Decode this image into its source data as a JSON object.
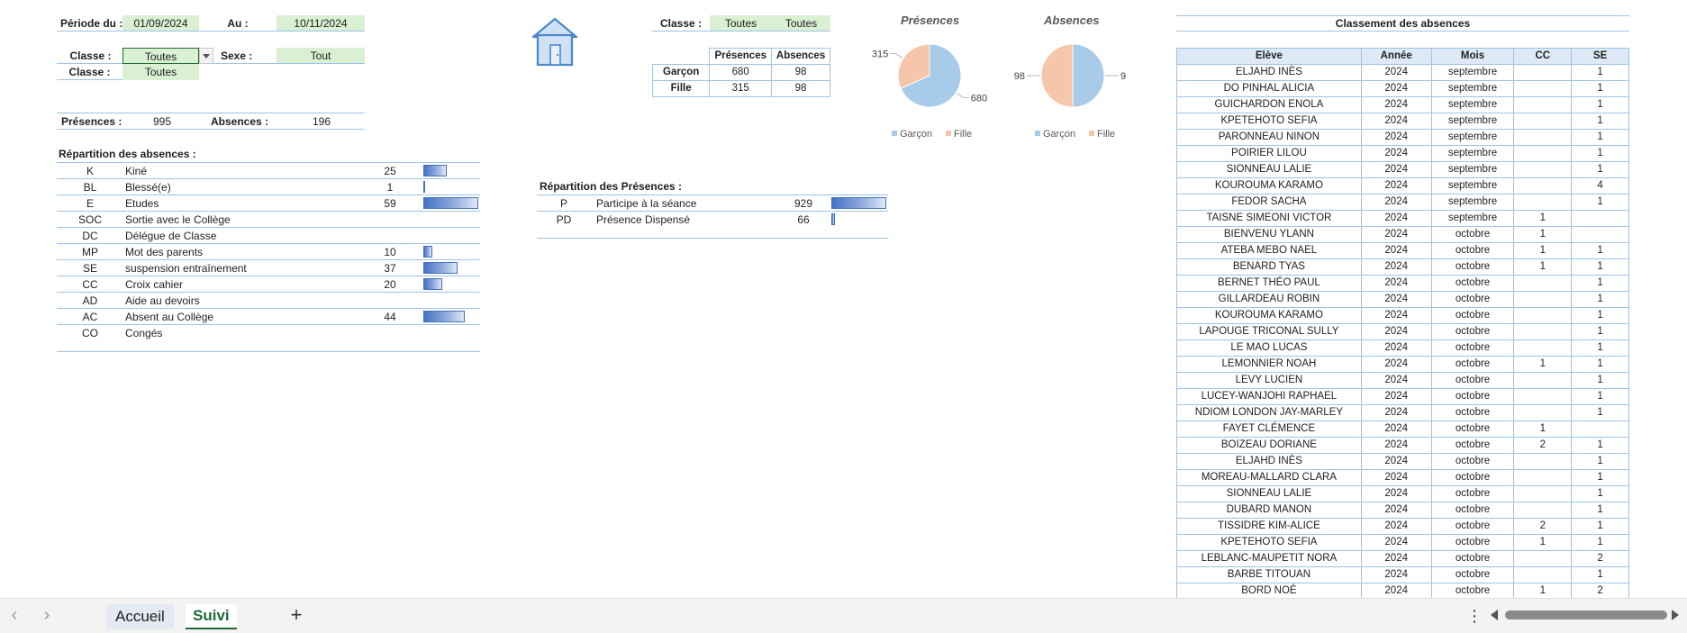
{
  "filters": {
    "periode_label": "Période du :",
    "periode_from": "01/09/2024",
    "au_label": "Au :",
    "periode_to": "10/11/2024",
    "classe_label": "Classe :",
    "classe_value": "Toutes",
    "sexe_label": "Sexe :",
    "sexe_value": "Tout",
    "classe2_label": "Classe :",
    "classe2_value": "Toutes"
  },
  "totals": {
    "presences_label": "Présences :",
    "presences_value": "995",
    "absences_label": "Absences :",
    "absences_value": "196"
  },
  "absences_breakdown": {
    "title": "Répartition des absences :",
    "rows": [
      {
        "code": "K",
        "label": "Kiné",
        "value": "25",
        "fraction": 0.42
      },
      {
        "code": "BL",
        "label": "Blessé(e)",
        "value": "1",
        "fraction": 0.02
      },
      {
        "code": "E",
        "label": "Etudes",
        "value": "59",
        "fraction": 1.0
      },
      {
        "code": "SOC",
        "label": "Sortie avec le Collège",
        "value": "",
        "fraction": 0
      },
      {
        "code": "DC",
        "label": "Délégue de Classe",
        "value": "",
        "fraction": 0
      },
      {
        "code": "MP",
        "label": "Mot des parents",
        "value": "10",
        "fraction": 0.17
      },
      {
        "code": "SE",
        "label": "suspension entraînement",
        "value": "37",
        "fraction": 0.63
      },
      {
        "code": "CC",
        "label": "Croix cahier",
        "value": "20",
        "fraction": 0.34
      },
      {
        "code": "AD",
        "label": "Aide au devoirs",
        "value": "",
        "fraction": 0
      },
      {
        "code": "AC",
        "label": "Absent au Collège",
        "value": "44",
        "fraction": 0.75
      },
      {
        "code": "CO",
        "label": "Congés",
        "value": "",
        "fraction": 0
      }
    ]
  },
  "presences_breakdown": {
    "title": "Répartition des Présences :",
    "rows": [
      {
        "code": "P",
        "label": "Participe à la séance",
        "value": "929",
        "fraction": 1.0
      },
      {
        "code": "PD",
        "label": "Présence Dispensé",
        "value": "66",
        "fraction": 0.07
      }
    ]
  },
  "summary": {
    "classe_label": "Classe :",
    "classe_value1": "Toutes",
    "classe_value2": "Toutes",
    "col_presences": "Présences",
    "col_absences": "Absences",
    "rows": [
      {
        "label": "Garçon",
        "presences": "680",
        "absences": "98"
      },
      {
        "label": "Fille",
        "presences": "315",
        "absences": "98"
      }
    ]
  },
  "chart_data": [
    {
      "type": "pie",
      "title": "Présences",
      "categories": [
        "Garçon",
        "Fille"
      ],
      "values": [
        680,
        315
      ],
      "colors": [
        "#a9cbea",
        "#f6c6aa"
      ],
      "legend": "bottom"
    },
    {
      "type": "pie",
      "title": "Absences",
      "categories": [
        "Garçon",
        "Fille"
      ],
      "values": [
        98,
        98
      ],
      "colors": [
        "#a9cbea",
        "#f6c6aa"
      ],
      "legend": "bottom"
    }
  ],
  "ranking": {
    "title": "Classement des absences",
    "columns": [
      "Elève",
      "Année",
      "Mois",
      "CC",
      "SE"
    ],
    "rows": [
      [
        "ELJAHD INÈS",
        "2024",
        "septembre",
        "",
        "1"
      ],
      [
        "DO PINHAL ALICIA",
        "2024",
        "septembre",
        "",
        "1"
      ],
      [
        "GUICHARDON ENOLA",
        "2024",
        "septembre",
        "",
        "1"
      ],
      [
        "KPETEHOTO SEFIA",
        "2024",
        "septembre",
        "",
        "1"
      ],
      [
        "PARONNEAU NINON",
        "2024",
        "septembre",
        "",
        "1"
      ],
      [
        "POIRIER LILOU",
        "2024",
        "septembre",
        "",
        "1"
      ],
      [
        "SIONNEAU LALIE",
        "2024",
        "septembre",
        "",
        "1"
      ],
      [
        "KOUROUMA KARAMO",
        "2024",
        "septembre",
        "",
        "4"
      ],
      [
        "FEDOR SACHA",
        "2024",
        "septembre",
        "",
        "1"
      ],
      [
        "TAISNE SIMEONI VICTOR",
        "2024",
        "septembre",
        "1",
        ""
      ],
      [
        "BIENVENU YLANN",
        "2024",
        "octobre",
        "1",
        ""
      ],
      [
        "ATEBA MEBO NAEL",
        "2024",
        "octobre",
        "1",
        "1"
      ],
      [
        "BENARD TYAS",
        "2024",
        "octobre",
        "1",
        "1"
      ],
      [
        "BERNET  THÉO PAUL",
        "2024",
        "octobre",
        "",
        "1"
      ],
      [
        "GILLARDEAU ROBIN",
        "2024",
        "octobre",
        "",
        "1"
      ],
      [
        "KOUROUMA KARAMO",
        "2024",
        "octobre",
        "",
        "1"
      ],
      [
        "LAPOUGE TRICONAL SULLY",
        "2024",
        "octobre",
        "",
        "1"
      ],
      [
        "LE MAO LUCAS",
        "2024",
        "octobre",
        "",
        "1"
      ],
      [
        "LEMONNIER NOAH",
        "2024",
        "octobre",
        "1",
        "1"
      ],
      [
        "LEVY LUCIEN",
        "2024",
        "octobre",
        "",
        "1"
      ],
      [
        "LUCEY-WANJOHI RAPHAEL",
        "2024",
        "octobre",
        "",
        "1"
      ],
      [
        "NDIOM LONDON JAY-MARLEY",
        "2024",
        "octobre",
        "",
        "1"
      ],
      [
        "FAYET  CLÉMENCE",
        "2024",
        "octobre",
        "1",
        ""
      ],
      [
        "BOIZEAU DORIANE",
        "2024",
        "octobre",
        "2",
        "1"
      ],
      [
        "ELJAHD INÈS",
        "2024",
        "octobre",
        "",
        "1"
      ],
      [
        "MOREAU-MALLARD CLARA",
        "2024",
        "octobre",
        "",
        "1"
      ],
      [
        "SIONNEAU LALIE",
        "2024",
        "octobre",
        "",
        "1"
      ],
      [
        "DUBARD MANON",
        "2024",
        "octobre",
        "",
        "1"
      ],
      [
        "TISSIDRE KIM-ALICE",
        "2024",
        "octobre",
        "2",
        "1"
      ],
      [
        "KPETEHOTO SEFIA",
        "2024",
        "octobre",
        "1",
        "1"
      ],
      [
        "LEBLANC-MAUPETIT NORA",
        "2024",
        "octobre",
        "",
        "2"
      ],
      [
        "BARBE TITOUAN",
        "2024",
        "octobre",
        "",
        "1"
      ],
      [
        "BORD NOÉ",
        "2024",
        "octobre",
        "1",
        "2"
      ]
    ]
  },
  "sheet_tabs": {
    "tabs": [
      "Accueil",
      "Suivi"
    ],
    "active": "Suivi",
    "add_icon": "plus-icon"
  },
  "accent_color": "#4472c4",
  "filter_fill": "#d9f0d3"
}
